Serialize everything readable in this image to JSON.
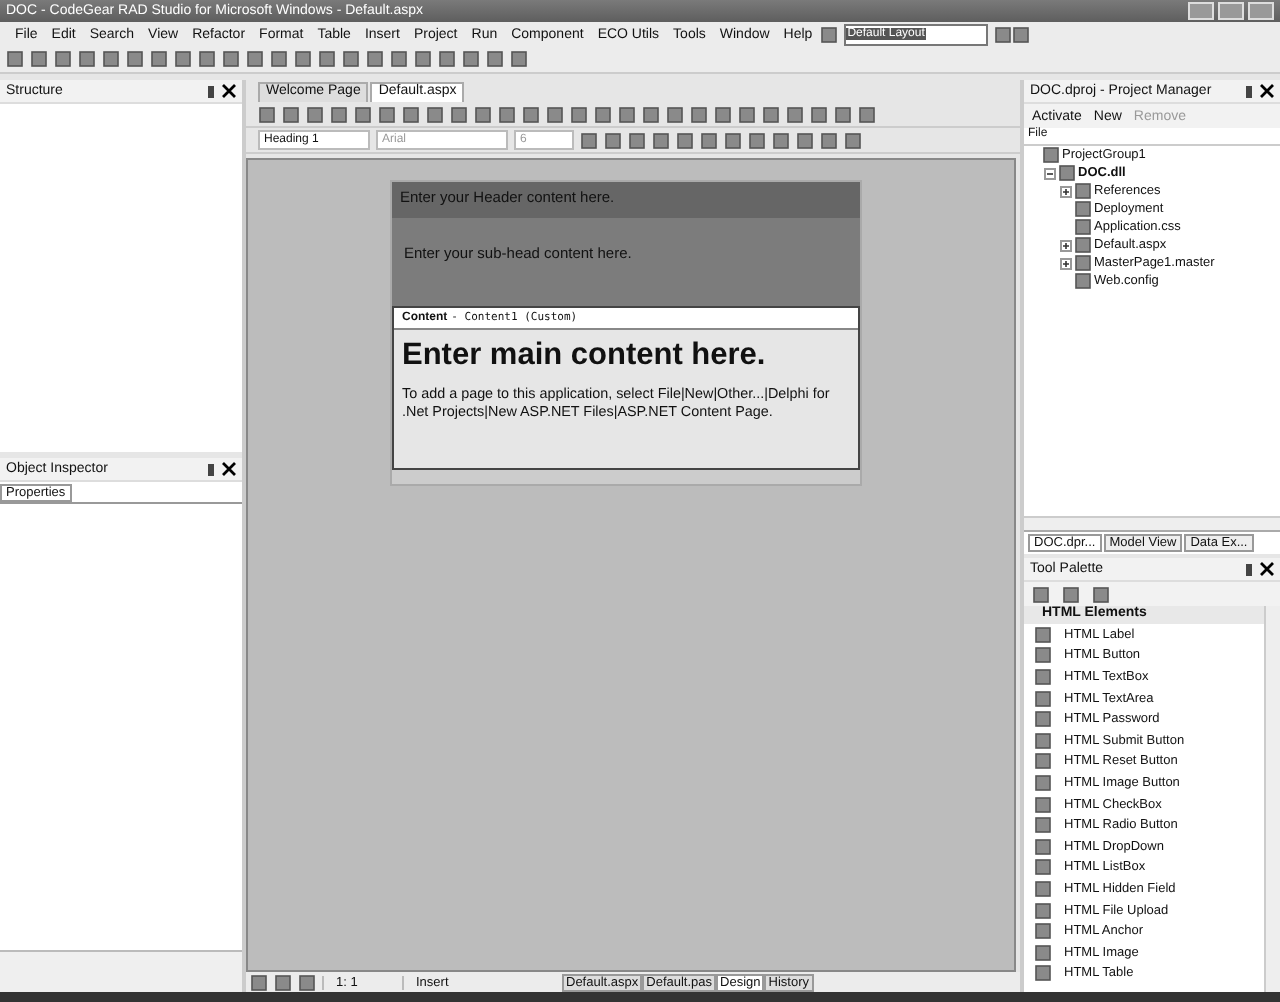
{
  "window": {
    "title": "DOC - CodeGear RAD Studio for Microsoft Windows - Default.aspx"
  },
  "menu": [
    "File",
    "Edit",
    "Search",
    "View",
    "Refactor",
    "Format",
    "Table",
    "Insert",
    "Project",
    "Run",
    "Component",
    "ECO Utils",
    "Tools",
    "Window",
    "Help"
  ],
  "layout_combo": {
    "value": "Default Layout"
  },
  "structure": {
    "title": "Structure"
  },
  "object_inspector": {
    "title": "Object Inspector",
    "tabs": [
      {
        "label": "Properties",
        "selected": true
      }
    ]
  },
  "editor_tabs": [
    {
      "label": "Welcome Page",
      "selected": false
    },
    {
      "label": "Default.aspx",
      "selected": true
    }
  ],
  "format_bar": {
    "block_style": "Heading 1",
    "font": "Arial",
    "size": "6"
  },
  "page": {
    "header": "Enter your Header content here.",
    "subhead": "Enter your sub-head content here.",
    "content_label": "Content",
    "content_caption": "- Content1 (Custom)",
    "heading": "Enter main content here.",
    "body": "To add a page to this application, select File|New|Other...|Delphi for .Net Projects|New ASP.NET Files|ASP.NET Content Page."
  },
  "status_bar": {
    "position": "1:  1",
    "mode": "Insert",
    "view_tabs": [
      {
        "label": "Default.aspx",
        "selected": false
      },
      {
        "label": "Default.pas",
        "selected": false
      },
      {
        "label": "Design",
        "selected": true
      },
      {
        "label": "History",
        "selected": false
      }
    ]
  },
  "project_manager": {
    "title": "DOC.dproj - Project Manager",
    "toolbar": [
      {
        "label": "Activate",
        "disabled": false
      },
      {
        "label": "New",
        "disabled": false
      },
      {
        "label": "Remove",
        "disabled": true
      }
    ],
    "column": "File",
    "tree": [
      {
        "label": "ProjectGroup1",
        "active": false,
        "kind": "root",
        "children": [
          {
            "label": "DOC.dll",
            "active": true,
            "kind": "group",
            "expanded": true,
            "children": [
              {
                "label": "References",
                "active": false,
                "kind": "group",
                "expanded": false
              },
              {
                "label": "Deployment",
                "active": false,
                "kind": "file"
              },
              {
                "label": "Application.css",
                "active": false,
                "kind": "file"
              },
              {
                "label": "Default.aspx",
                "active": false,
                "kind": "group",
                "expanded": false
              },
              {
                "label": "MasterPage1.master",
                "active": false,
                "kind": "group",
                "expanded": false
              },
              {
                "label": "Web.config",
                "active": false,
                "kind": "file"
              }
            ]
          }
        ]
      }
    ],
    "tabs": [
      {
        "label": "DOC.dpr...",
        "selected": true
      },
      {
        "label": "Model View",
        "selected": false
      },
      {
        "label": "Data Ex...",
        "selected": false
      }
    ]
  },
  "tool_palette": {
    "title": "Tool Palette",
    "category": "HTML Elements",
    "items": [
      "HTML Label",
      "HTML Button",
      "HTML TextBox",
      "HTML TextArea",
      "HTML Password",
      "HTML Submit Button",
      "HTML Reset Button",
      "HTML Image Button",
      "HTML CheckBox",
      "HTML Radio Button",
      "HTML DropDown",
      "HTML ListBox",
      "HTML Hidden Field",
      "HTML File Upload",
      "HTML Anchor",
      "HTML Image",
      "HTML Table"
    ]
  }
}
